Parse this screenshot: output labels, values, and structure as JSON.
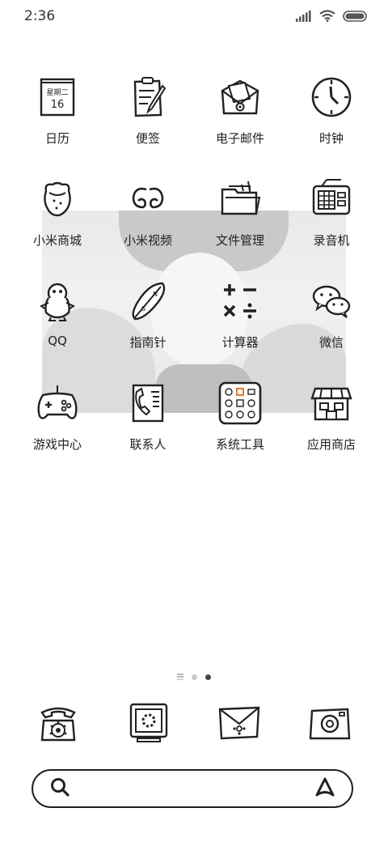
{
  "status_bar": {
    "time": "2:36",
    "icons": [
      "signal-icon",
      "wifi-icon",
      "battery-icon"
    ]
  },
  "home_grid": {
    "apps": [
      {
        "label": "日历",
        "icon": "calendar-icon",
        "calendar_weekday": "星期二",
        "calendar_day": "16"
      },
      {
        "label": "便签",
        "icon": "notes-icon"
      },
      {
        "label": "电子邮件",
        "icon": "email-icon"
      },
      {
        "label": "时钟",
        "icon": "clock-icon"
      },
      {
        "label": "小米商城",
        "icon": "mi-store-icon"
      },
      {
        "label": "小米视频",
        "icon": "mi-video-icon"
      },
      {
        "label": "文件管理",
        "icon": "file-manager-icon"
      },
      {
        "label": "录音机",
        "icon": "recorder-icon"
      },
      {
        "label": "QQ",
        "icon": "qq-icon"
      },
      {
        "label": "指南针",
        "icon": "compass-icon"
      },
      {
        "label": "计算器",
        "icon": "calculator-icon"
      },
      {
        "label": "微信",
        "icon": "wechat-icon"
      },
      {
        "label": "游戏中心",
        "icon": "game-center-icon"
      },
      {
        "label": "联系人",
        "icon": "contacts-icon"
      },
      {
        "label": "系统工具",
        "icon": "system-tools-folder-icon"
      },
      {
        "label": "应用商店",
        "icon": "app-store-icon"
      }
    ]
  },
  "page_indicator": {
    "pages": 2,
    "active_page": 2
  },
  "dock": {
    "apps": [
      {
        "icon": "phone-icon"
      },
      {
        "icon": "messages-icon"
      },
      {
        "icon": "browser-icon"
      },
      {
        "icon": "camera-icon"
      }
    ]
  },
  "search_bar": {
    "left_icon": "search-icon",
    "right_icon": "assistant-icon"
  },
  "colors": {
    "background": "#ffffff",
    "icon_stroke": "#222222",
    "folder_accent": "#e8772e"
  }
}
